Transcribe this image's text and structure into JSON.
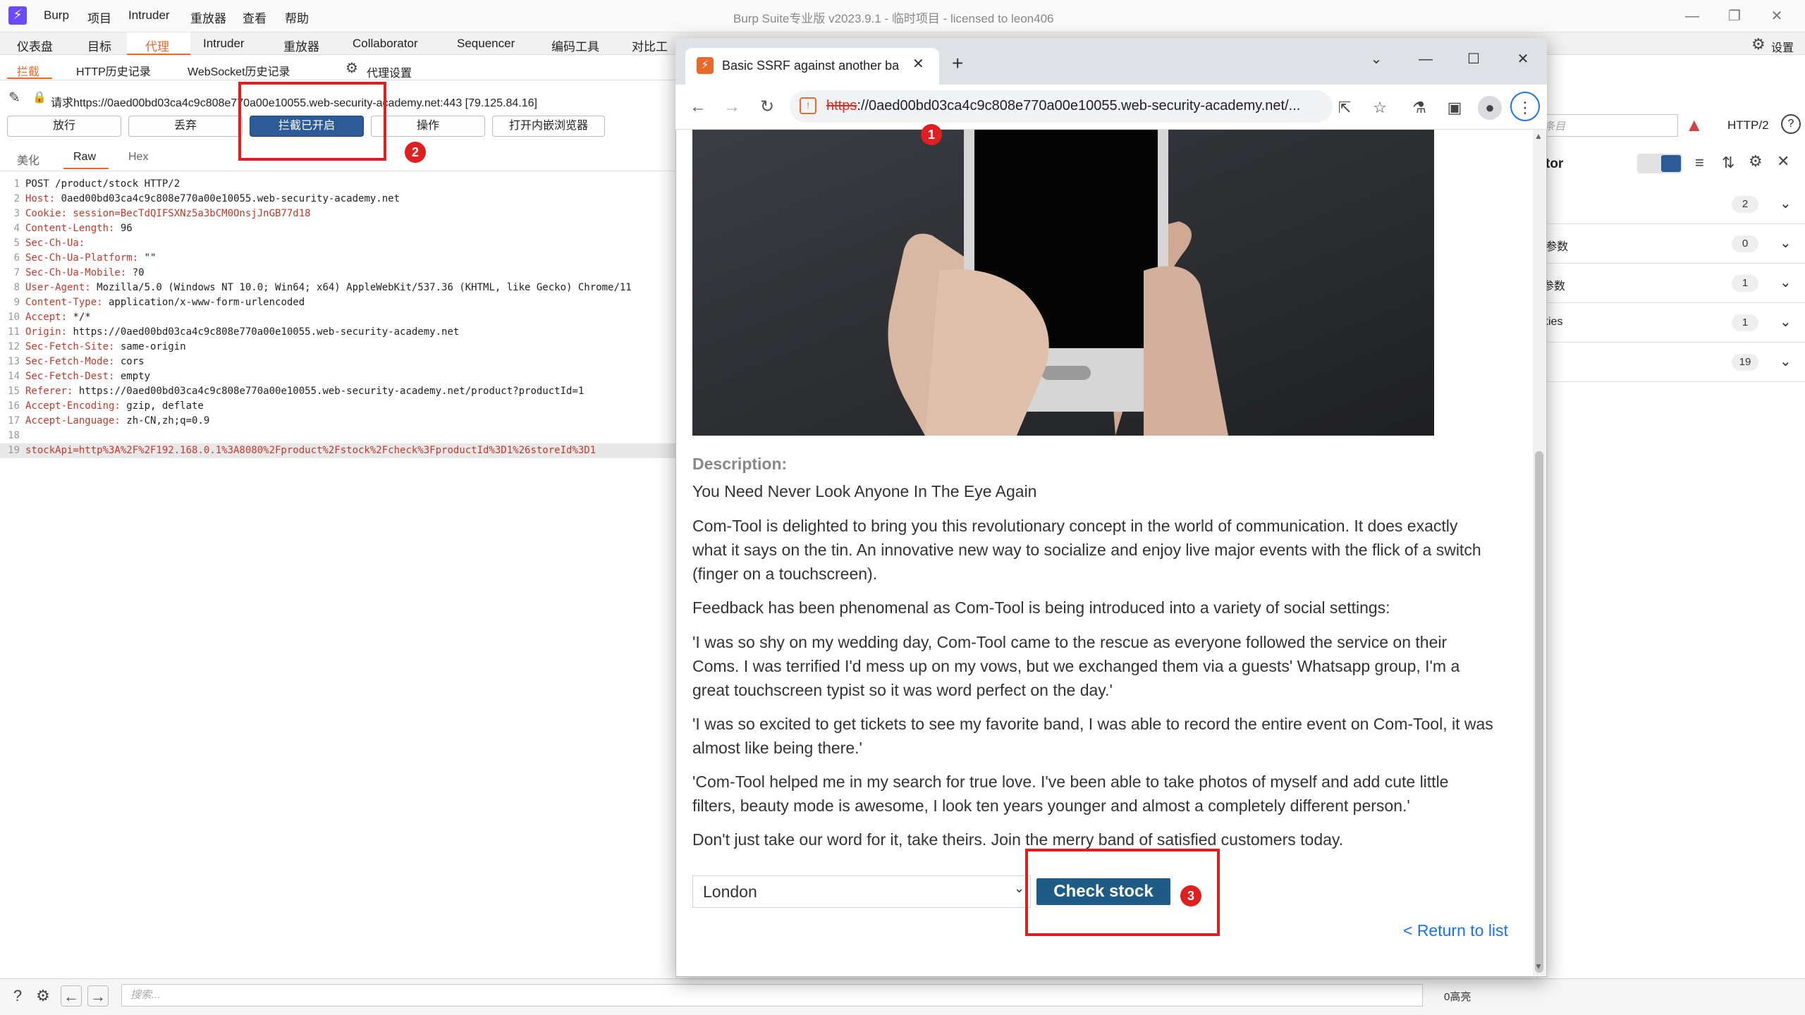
{
  "burp": {
    "logo": "⚡",
    "menu": [
      "Burp",
      "项目",
      "Intruder",
      "重放器",
      "查看",
      "帮助"
    ],
    "window_title": "Burp Suite专业版  v2023.9.1 - 临时项目 - licensed to leon406",
    "settings_label": "设置",
    "main_tabs": [
      "仪表盘",
      "目标",
      "代理",
      "Intruder",
      "重放器",
      "Collaborator",
      "Sequencer",
      "编码工具",
      "对比工"
    ],
    "sub_tabs": [
      "拦截",
      "HTTP历史记录",
      "WebSocket历史记录",
      "代理设置"
    ],
    "request_target": "请求https://0aed00bd03ca4c9c808e770a00e10055.web-security-academy.net:443  [79.125.84.16]",
    "buttons": {
      "forward": "放行",
      "drop": "丢弃",
      "intercept": "拦截已开启",
      "action": "操作",
      "open_browser": "打开内嵌浏览器"
    },
    "editor_tabs": [
      "美化",
      "Raw",
      "Hex"
    ],
    "request_lines": [
      {
        "n": "1",
        "k": "",
        "v": "POST /product/stock HTTP/2"
      },
      {
        "n": "2",
        "k": "Host:",
        "v": " 0aed00bd03ca4c9c808e770a00e10055.web-security-academy.net"
      },
      {
        "n": "3",
        "k": "Cookie: session=BecTdQIFSXNz5a3bCM0OnsjJnGB77d18",
        "v": ""
      },
      {
        "n": "4",
        "k": "Content-Length:",
        "v": " 96"
      },
      {
        "n": "5",
        "k": "Sec-Ch-Ua:",
        "v": ""
      },
      {
        "n": "6",
        "k": "Sec-Ch-Ua-Platform:",
        "v": " \"\""
      },
      {
        "n": "7",
        "k": "Sec-Ch-Ua-Mobile:",
        "v": " ?0"
      },
      {
        "n": "8",
        "k": "User-Agent:",
        "v": " Mozilla/5.0 (Windows NT 10.0; Win64; x64) AppleWebKit/537.36 (KHTML, like Gecko) Chrome/11"
      },
      {
        "n": "9",
        "k": "Content-Type:",
        "v": " application/x-www-form-urlencoded"
      },
      {
        "n": "10",
        "k": "Accept:",
        "v": " */*"
      },
      {
        "n": "11",
        "k": "Origin:",
        "v": " https://0aed00bd03ca4c9c808e770a00e10055.web-security-academy.net"
      },
      {
        "n": "12",
        "k": "Sec-Fetch-Site:",
        "v": " same-origin"
      },
      {
        "n": "13",
        "k": "Sec-Fetch-Mode:",
        "v": " cors"
      },
      {
        "n": "14",
        "k": "Sec-Fetch-Dest:",
        "v": " empty"
      },
      {
        "n": "15",
        "k": "Referer:",
        "v": " https://0aed00bd03ca4c9c808e770a00e10055.web-security-academy.net/product?productId=1"
      },
      {
        "n": "16",
        "k": "Accept-Encoding:",
        "v": " gzip, deflate"
      },
      {
        "n": "17",
        "k": "Accept-Language:",
        "v": " zh-CN,zh;q=0.9"
      },
      {
        "n": "18",
        "k": "",
        "v": ""
      },
      {
        "n": "19",
        "k": "stockApi=http%3A%2F%2F192.168.0.1%3A8080%2Fproduct%2Fstock%2Fcheck%3FproductId%3D1%26storeId%3D1",
        "v": ""
      }
    ],
    "search_placeholder": "搜索...",
    "highlight_count": "0高亮",
    "inspector": {
      "search_partial": "条目",
      "protocol": "HTTP/2",
      "title_partial": "tor",
      "rows": [
        {
          "label": ":",
          "count": "2"
        },
        {
          "label": "|参数",
          "count": "0"
        },
        {
          "label": "参数",
          "count": "1"
        },
        {
          "label": "kies",
          "count": "1"
        },
        {
          "label": "",
          "count": "19"
        }
      ]
    }
  },
  "chrome": {
    "tab_title": "Basic SSRF against another ba",
    "url_scheme": "https",
    "url_rest": "://0aed00bd03ca4c9c808e770a00e10055.web-security-academy.net/...",
    "page": {
      "description_label": "Description:",
      "paragraphs": [
        "You Need Never Look Anyone In The Eye Again",
        "Com-Tool is delighted to bring you this revolutionary concept in the world of communication. It does exactly what it says on the tin. An innovative new way to socialize and enjoy live major events with the flick of a switch (finger on a touchscreen).",
        "Feedback has been phenomenal as Com-Tool is being introduced into a variety of social settings:",
        "'I was so shy on my wedding day, Com-Tool came to the rescue as everyone followed the service on their Coms. I was terrified I'd mess up on my vows, but we exchanged them via a guests' Whatsapp group, I'm a great touchscreen typist so it was word perfect on the day.'",
        "'I was so excited to get tickets to see my favorite band, I was able to record the entire event on Com-Tool, it was almost like being there.'",
        "'Com-Tool helped me in my search for true love. I've been able to take photos of myself and add cute little filters, beauty mode is awesome, I look ten years younger and almost a completely different person.'",
        "Don't just take our word for it, take theirs. Join the merry band of satisfied customers today."
      ],
      "store_selected": "London",
      "check_stock": "Check stock",
      "return_link": "< Return to list"
    }
  },
  "annotations": [
    "1",
    "2",
    "3"
  ],
  "colors": {
    "burp_accent": "#e8692b",
    "intercept_button": "#2c5b98",
    "check_stock_button": "#1e5c86",
    "annotation": "#e02020"
  }
}
